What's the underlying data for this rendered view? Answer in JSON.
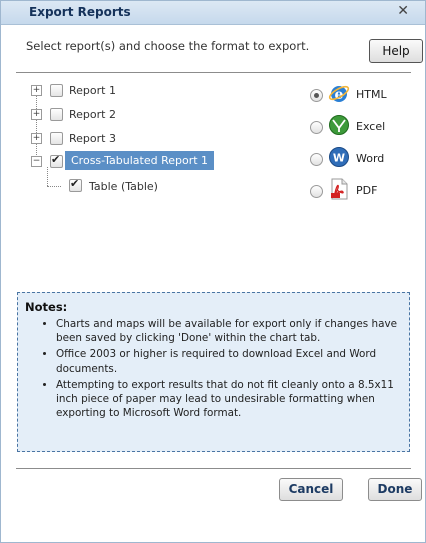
{
  "dialog": {
    "title": "Export Reports",
    "close_glyph": "✕"
  },
  "intro": "Select report(s) and choose the format to export.",
  "help_label": "Help",
  "tree": {
    "items": [
      {
        "label": "Report 1",
        "expanded": false,
        "checked": false
      },
      {
        "label": "Report 2",
        "expanded": false,
        "checked": false
      },
      {
        "label": "Report 3",
        "expanded": false,
        "checked": false
      },
      {
        "label": "Cross-Tabulated Report 1",
        "expanded": true,
        "checked": true,
        "selected": true
      }
    ],
    "child": {
      "label": "Table (Table)",
      "checked": true
    }
  },
  "formats": [
    {
      "label": "HTML",
      "icon": "ie-icon",
      "selected": true
    },
    {
      "label": "Excel",
      "icon": "excel-icon",
      "selected": false
    },
    {
      "label": "Word",
      "icon": "word-icon",
      "selected": false
    },
    {
      "label": "PDF",
      "icon": "pdf-icon",
      "selected": false
    }
  ],
  "notes": {
    "title": "Notes:",
    "items": [
      "Charts and maps will be available for export only if changes have been saved by clicking 'Done' within the chart tab.",
      "Office 2003 or higher is required to download Excel and Word documents.",
      "Attempting to export results that do not fit cleanly onto a 8.5x11 inch piece of paper may lead to undesirable formatting when exporting to Microsoft Word format."
    ]
  },
  "buttons": {
    "cancel": "Cancel",
    "done": "Done"
  },
  "colors": {
    "titlebar": "#c6d9ec",
    "selection": "#5b8fc6",
    "notes_bg": "#e4eef8",
    "notes_border": "#4a75a3"
  }
}
